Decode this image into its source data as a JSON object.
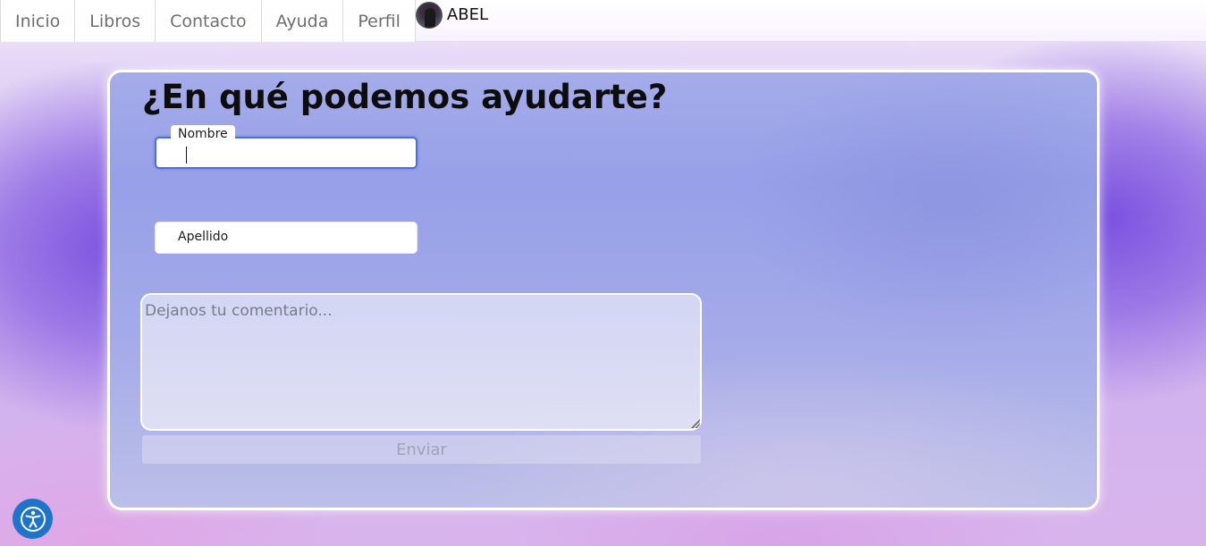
{
  "nav": {
    "items": [
      "Inicio",
      "Libros",
      "Contacto",
      "Ayuda",
      "Perfil"
    ],
    "user_name": "ABEL"
  },
  "form": {
    "title": "¿En qué podemos ayudarte?",
    "nombre_label": "Nombre",
    "apellido_label": "Apellido",
    "comment_placeholder": "Dejanos tu comentario...",
    "submit_label": "Enviar"
  },
  "icons": {
    "accessibility": "accessibility-icon",
    "avatar": "user-avatar"
  },
  "colors": {
    "accent": "#1e74c8",
    "focus_border": "#4f6fd8",
    "card_bg": "#9ca3e8"
  }
}
